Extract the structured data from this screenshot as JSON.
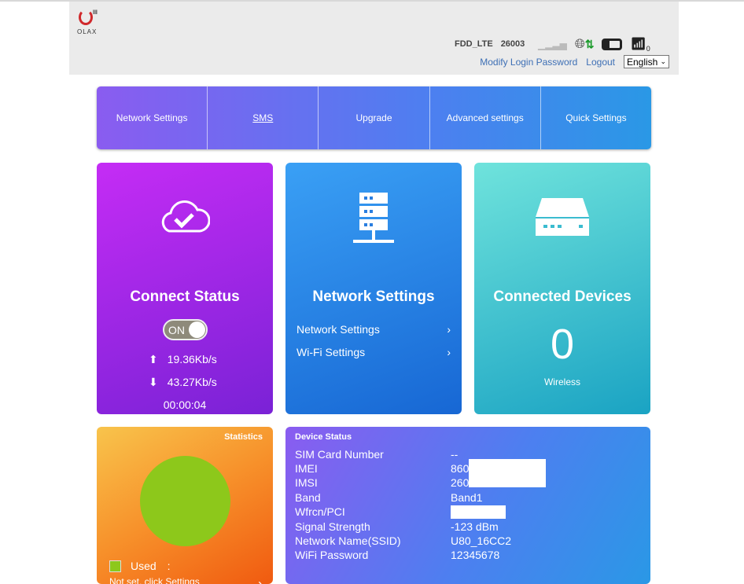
{
  "header": {
    "logo_text": "OLAX",
    "network_type": "FDD_LTE",
    "operator": "26003",
    "modify_password": "Modify Login Password",
    "logout": "Logout",
    "language": "English",
    "wifi_clients": "0"
  },
  "nav": [
    "Network Settings",
    "SMS",
    "Upgrade",
    "Advanced settings",
    "Quick Settings"
  ],
  "connect": {
    "title": "Connect Status",
    "toggle": "ON",
    "upload": "19.36Kb/s",
    "download": "43.27Kb/s",
    "duration": "00:00:04"
  },
  "network": {
    "title": "Network Settings",
    "links": [
      "Network Settings",
      "Wi-Fi Settings"
    ]
  },
  "devices": {
    "title": "Connected Devices",
    "count": "0",
    "label": "Wireless"
  },
  "statistics": {
    "title": "Statistics",
    "used_label": "Used　:",
    "notice": "Not set, click Settings",
    "used_color": "#8dc81b"
  },
  "device_status": {
    "title": "Device Status",
    "rows": [
      {
        "k": "SIM Card Number",
        "v": "--"
      },
      {
        "k": "IMEI",
        "v": "860"
      },
      {
        "k": "IMSI",
        "v": "260"
      },
      {
        "k": "Band",
        "v": "Band1"
      },
      {
        "k": "Wfrcn/PCI",
        "v": ""
      },
      {
        "k": "Signal Strength",
        "v": "-123 dBm"
      },
      {
        "k": "Network Name(SSID)",
        "v": "U80_16CC2"
      },
      {
        "k": "WiFi Password",
        "v": "12345678"
      }
    ]
  }
}
